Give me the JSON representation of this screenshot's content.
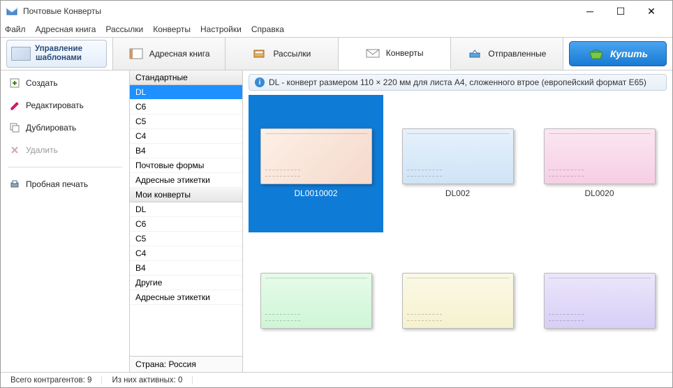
{
  "title": "Почтовые Конверты",
  "menu": [
    "Файл",
    "Адресная книга",
    "Рассылки",
    "Конверты",
    "Настройки",
    "Справка"
  ],
  "template_btn": {
    "line1": "Управление",
    "line2": "шаблонами"
  },
  "toolbar_tabs": [
    {
      "label": "Адресная книга",
      "active": false
    },
    {
      "label": "Рассылки",
      "active": false
    },
    {
      "label": "Конверты",
      "active": true
    },
    {
      "label": "Отправленные",
      "active": false
    }
  ],
  "buy_label": "Купить",
  "sidebar": [
    {
      "label": "Создать",
      "icon": "create",
      "disabled": false
    },
    {
      "label": "Редактировать",
      "icon": "edit",
      "disabled": false
    },
    {
      "label": "Дублировать",
      "icon": "duplicate",
      "disabled": false
    },
    {
      "label": "Удалить",
      "icon": "delete",
      "disabled": true
    },
    {
      "label": "Пробная печать",
      "icon": "print",
      "disabled": false
    }
  ],
  "categories": {
    "groups": [
      {
        "header": "Стандартные",
        "items": [
          "DL",
          "C6",
          "C5",
          "C4",
          "B4",
          "Почтовые формы",
          "Адресные этикетки"
        ]
      },
      {
        "header": "Мои конверты",
        "items": [
          "DL",
          "C6",
          "C5",
          "C4",
          "B4",
          "Другие",
          "Адресные этикетки"
        ]
      }
    ],
    "selected": "DL",
    "footer_label": "Страна:",
    "footer_value": "Россия"
  },
  "info_text": "DL - конверт размером 110 × 220 мм для листа A4, сложенного втрое (европейский формат E65)",
  "gallery": [
    {
      "id": "DL0010002",
      "style": "floral",
      "selected": true
    },
    {
      "id": "DL002",
      "style": "blue",
      "selected": false
    },
    {
      "id": "DL0020",
      "style": "pink",
      "selected": false
    },
    {
      "id": "",
      "style": "green",
      "selected": false
    },
    {
      "id": "",
      "style": "yellow",
      "selected": false
    },
    {
      "id": "",
      "style": "lilac",
      "selected": false
    }
  ],
  "status": {
    "counter_label": "Всего контрагентов:",
    "counter_value": "9",
    "active_label": "Из них активных:",
    "active_value": "0"
  }
}
